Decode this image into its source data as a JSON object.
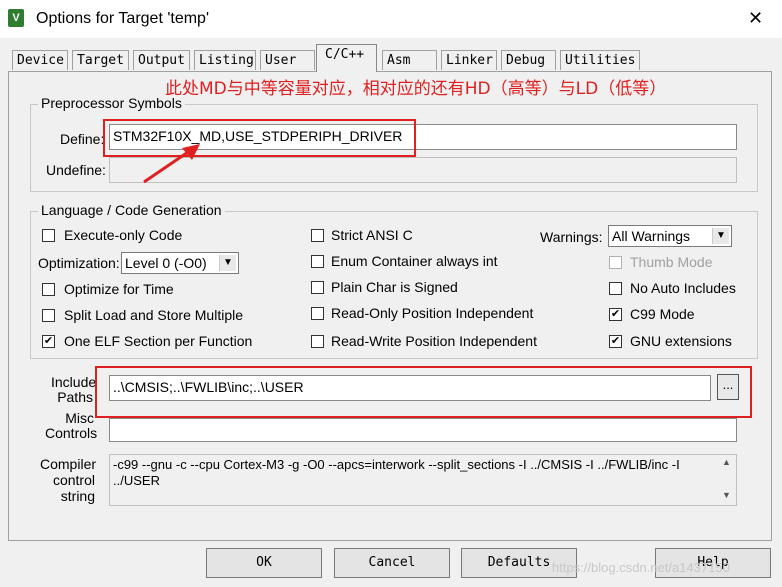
{
  "window": {
    "title": "Options for Target 'temp'",
    "icon": "keil-uvision-icon",
    "close_glyph": "✕"
  },
  "tabs": [
    {
      "label": "Device"
    },
    {
      "label": "Target"
    },
    {
      "label": "Output"
    },
    {
      "label": "Listing"
    },
    {
      "label": "User"
    },
    {
      "label": "C/C++",
      "active": true
    },
    {
      "label": "Asm"
    },
    {
      "label": "Linker"
    },
    {
      "label": "Debug"
    },
    {
      "label": "Utilities"
    }
  ],
  "annotation": {
    "text": "此处MD与中等容量对应，相对应的还有HD（高等）与LD（低等）",
    "color": "#e02020"
  },
  "preprocessor": {
    "group_label": "Preprocessor Symbols",
    "define_label": "Define:",
    "define_value": "STM32F10X_MD,USE_STDPERIPH_DRIVER",
    "undefine_label": "Undefine:",
    "undefine_value": ""
  },
  "language": {
    "group_label": "Language / Code Generation",
    "execute_only": {
      "label": "Execute-only Code",
      "checked": false
    },
    "optimization_label": "Optimization:",
    "optimization_value": "Level 0 (-O0)",
    "optimize_time": {
      "label": "Optimize for Time",
      "checked": false
    },
    "split_load": {
      "label": "Split Load and Store Multiple",
      "checked": false
    },
    "one_elf": {
      "label": "One ELF Section per Function",
      "checked": true
    },
    "strict_ansi": {
      "label": "Strict ANSI C",
      "checked": false
    },
    "enum_container": {
      "label": "Enum Container always int",
      "checked": false
    },
    "plain_char": {
      "label": "Plain Char is Signed",
      "checked": false
    },
    "ropi": {
      "label": "Read-Only Position Independent",
      "checked": false
    },
    "rwpi": {
      "label": "Read-Write Position Independent",
      "checked": false
    },
    "warnings_label": "Warnings:",
    "warnings_value": "All Warnings",
    "thumb_mode": {
      "label": "Thumb Mode",
      "checked": false
    },
    "no_auto_includes": {
      "label": "No Auto Includes",
      "checked": false
    },
    "c99_mode": {
      "label": "C99 Mode",
      "checked": true
    },
    "gnu_extensions": {
      "label": "GNU extensions",
      "checked": true
    }
  },
  "include_paths": {
    "label_line1": "Include",
    "label_line2": "Paths",
    "value": "..\\CMSIS;..\\FWLIB\\inc;..\\USER",
    "browse_label": "..."
  },
  "misc_controls": {
    "label_line1": "Misc",
    "label_line2": "Controls",
    "value": ""
  },
  "compiler_control": {
    "label_line1": "Compiler",
    "label_line2": "control",
    "label_line3": "string",
    "line1": "-c99 --gnu -c --cpu Cortex-M3 -g -O0 --apcs=interwork --split_sections -I ../CMSIS -I ../FWLIB/inc -I",
    "line2": "../USER"
  },
  "buttons": {
    "ok": "OK",
    "cancel": "Cancel",
    "defaults": "Defaults",
    "help": "Help"
  },
  "watermark": "https://blog.csdn.net/a1437150",
  "check_glyph": "✔"
}
